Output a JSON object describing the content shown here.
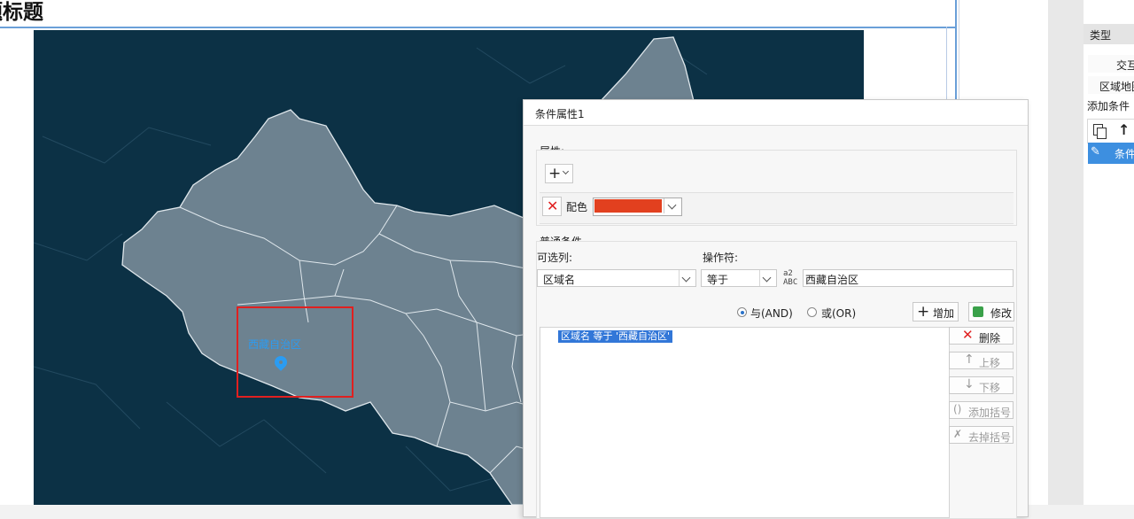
{
  "page": {
    "title": "题标题"
  },
  "map": {
    "region_label": "西藏自治区",
    "colors": {
      "ocean": "#0c3145",
      "land": "#6d8290",
      "highlight_box": "#e02020",
      "label": "#2b9cf2"
    }
  },
  "right_panel": {
    "header": "类型",
    "rows": [
      "交互",
      "区域地图"
    ],
    "add_condition_label": "添加条件",
    "selected_item": "条件"
  },
  "dialog": {
    "title": "条件属性1",
    "attributes_label": "属性:",
    "add_button": "+",
    "color_attr": {
      "label": "配色",
      "value": "#e2401f"
    },
    "normal_conditions_label": "普通条件",
    "column_label": "可选列:",
    "column_value": "区域名",
    "operator_label": "操作符:",
    "operator_value": "等于",
    "value_input": "西藏自治区",
    "logic": {
      "and_label": "与(AND)",
      "or_label": "或(OR)",
      "selected": "and"
    },
    "add_label": "增加",
    "modify_label": "修改",
    "condition_item": "区域名 等于 '西藏自治区'",
    "side_buttons": {
      "delete": "删除",
      "up": "上移",
      "down": "下移",
      "add_paren": "添加括号",
      "remove_paren": "去掉括号"
    }
  }
}
